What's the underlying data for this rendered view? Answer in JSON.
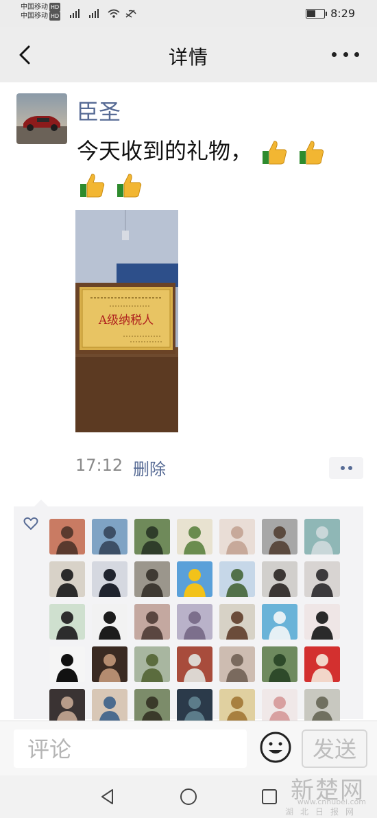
{
  "status_bar": {
    "carrier_1": "中国移动",
    "carrier_2": "中国移动",
    "hd_badge": "HD",
    "time": "8:29",
    "battery_level": 0.55
  },
  "header": {
    "title": "详情"
  },
  "post": {
    "username": "臣圣",
    "text": "今天收到的礼物，",
    "thumbs_emoji_count": 4,
    "plaque_text": "A级纳税人",
    "time": "17:12",
    "delete_label": "删除"
  },
  "likes": {
    "liker_count": 35
  },
  "comment_bar": {
    "placeholder": "评论",
    "send_label": "发送"
  },
  "watermark": {
    "logo": "新楚网",
    "url": "www.cnhubei.com",
    "name": "湖北日报网"
  },
  "colors": {
    "link_blue": "#576b95",
    "navbar_bg": "#ededed",
    "likes_bg": "#f3f3f5"
  }
}
